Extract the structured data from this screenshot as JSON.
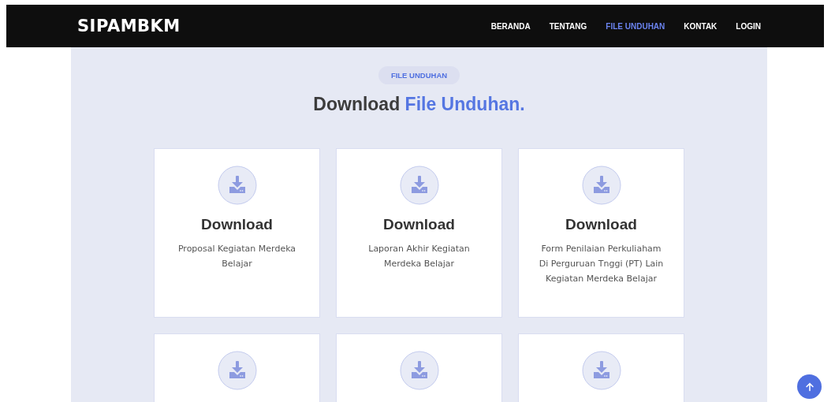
{
  "navbar": {
    "brand": "SIPAMBKM",
    "links": [
      {
        "label": "BERANDA",
        "selected": false
      },
      {
        "label": "TENTANG",
        "selected": false
      },
      {
        "label": "FILE UNDUHAN",
        "selected": true
      },
      {
        "label": "KONTAK",
        "selected": false
      },
      {
        "label": "LOGIN",
        "selected": false
      }
    ]
  },
  "section": {
    "badge": "FILE UNDUHAN",
    "heading": "Download **File Unduhan.**"
  },
  "cards": [
    {
      "kind": "download",
      "title": "Download",
      "description": "Proposal Kegiatan Merdeka Belajar"
    },
    {
      "kind": "download",
      "title": "Download",
      "description": "Laporan Akhir Kegiatan Merdeka Belajar"
    },
    {
      "kind": "download",
      "title": "Download",
      "description": "Form Penilaian Perkuliaham Di Perguruan Tnggi (PT) Lain Kegiatan Merdeka Belajar"
    },
    {
      "kind": "download"
    },
    {
      "kind": "download"
    },
    {
      "kind": "download"
    }
  ],
  "back_to_top": {
    "kind": "arrow-up"
  }
}
